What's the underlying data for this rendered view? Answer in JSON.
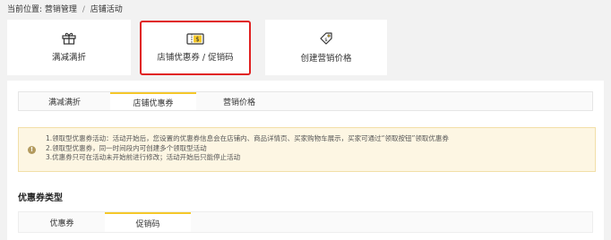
{
  "breadcrumb": {
    "label": "当前位置:",
    "items": [
      "营销管理",
      "店铺活动"
    ],
    "separator": "/"
  },
  "cards": [
    {
      "label": "满减满折",
      "icon": "gift-icon"
    },
    {
      "label": "店铺优惠券 / 促销码",
      "icon": "coupon-icon",
      "selected": true
    },
    {
      "label": "创建营销价格",
      "icon": "price-tag-icon"
    }
  ],
  "tabs": [
    {
      "label": "满减满折"
    },
    {
      "label": "店铺优惠券",
      "active": true
    },
    {
      "label": "营销价格"
    }
  ],
  "notice": {
    "icon": "info-icon",
    "lines": [
      "1.领取型优惠券活动：活动开始后，您设置的优惠券信息会在店铺内、商品详情页、买家购物车展示，买家可通过“领取按钮”领取优惠券",
      "2.领取型优惠券，同一时间段内可创建多个领取型活动",
      "3.优惠券只可在活动未开始前进行修改；活动开始后只能停止活动"
    ]
  },
  "section": {
    "title": "优惠券类型"
  },
  "type_tabs": [
    {
      "label": "优惠券"
    },
    {
      "label": "促销码",
      "active": true
    }
  ],
  "colors": {
    "accent": "#f5c82a",
    "highlight_border": "#e02020",
    "notice_bg": "#fdf6e3"
  }
}
